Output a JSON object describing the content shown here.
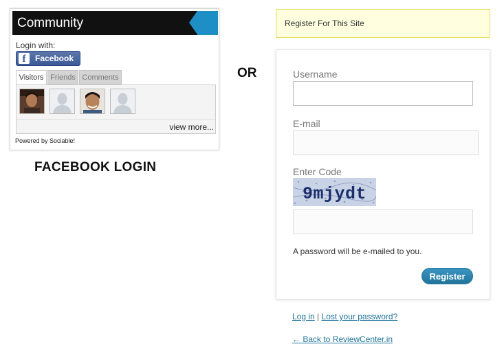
{
  "community_widget": {
    "title": "Community",
    "login_with": "Login with:",
    "facebook_button": "Facebook",
    "tabs": [
      {
        "label": "Visitors",
        "active": true
      },
      {
        "label": "Friends",
        "active": false
      },
      {
        "label": "Comments",
        "active": false
      }
    ],
    "view_more": "view more...",
    "powered_by": "Powered by Sociable!"
  },
  "captions": {
    "facebook_login": "FACEBOOK LOGIN",
    "or": "OR"
  },
  "register": {
    "notice": "Register For This Site",
    "username_label": "Username",
    "email_label": "E-mail",
    "code_label": "Enter Code",
    "captcha_text": "9mjydt",
    "password_note": "A password will be e-mailed to you.",
    "register_button": "Register"
  },
  "footer_links": {
    "login": "Log in",
    "separator": "|",
    "lost_password": "Lost your password?",
    "back": "← Back to ReviewCenter.in"
  },
  "colors": {
    "facebook_blue": "#3b5998",
    "accent_blue": "#21759b",
    "notice_bg": "#ffffe0"
  }
}
